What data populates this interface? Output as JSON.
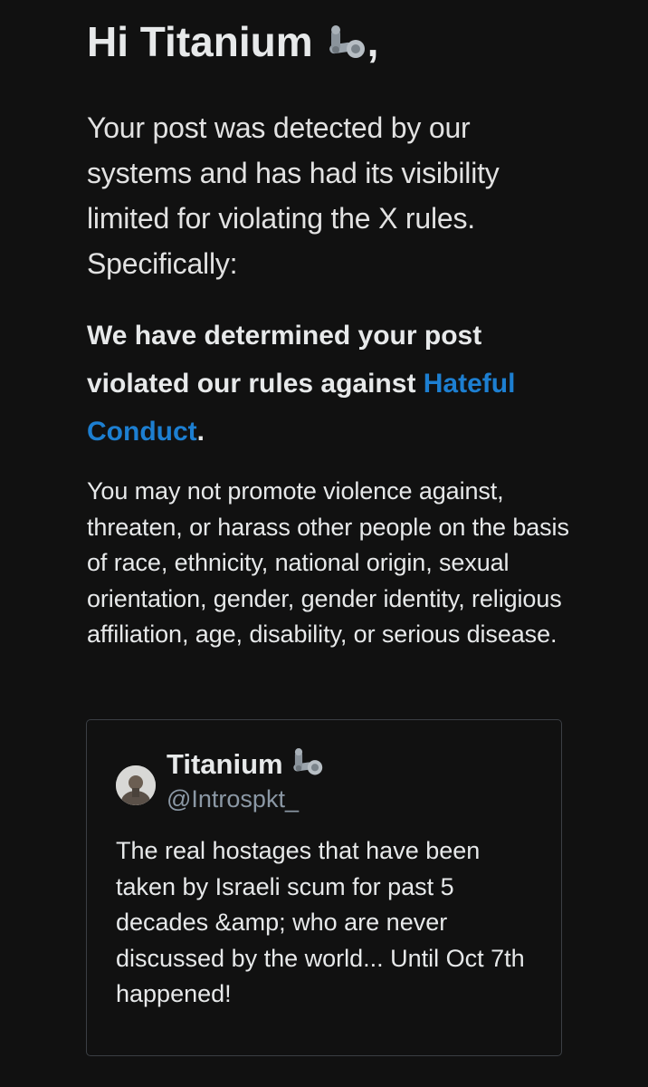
{
  "notice": {
    "greeting_prefix": "Hi Titanium",
    "greeting_suffix": ",",
    "greeting_emoji": "mechanical-arm-icon",
    "lead": "Your post was detected by our systems and has had its visibility limited for violating the X rules. Specifically:",
    "determination_prefix": "We have determined your post violated our rules against ",
    "determination_link": "Hateful Conduct",
    "determination_suffix": ".",
    "policy_text": "You may not promote violence against, threaten, or harass other people on the basis of race, ethnicity, national origin, sexual orientation, gender, gender identity, religious affiliation, age, disability, or serious disease.",
    "link_color": "#1d7fd1"
  },
  "post": {
    "display_name": "Titanium",
    "name_emoji": "mechanical-arm-icon",
    "handle": "@Introspkt_",
    "text": "The real hostages that have been taken by Israeli scum for past 5 decades &amp; who are never discussed by the world... Until Oct 7th happened!",
    "avatar": "avatar-image"
  }
}
